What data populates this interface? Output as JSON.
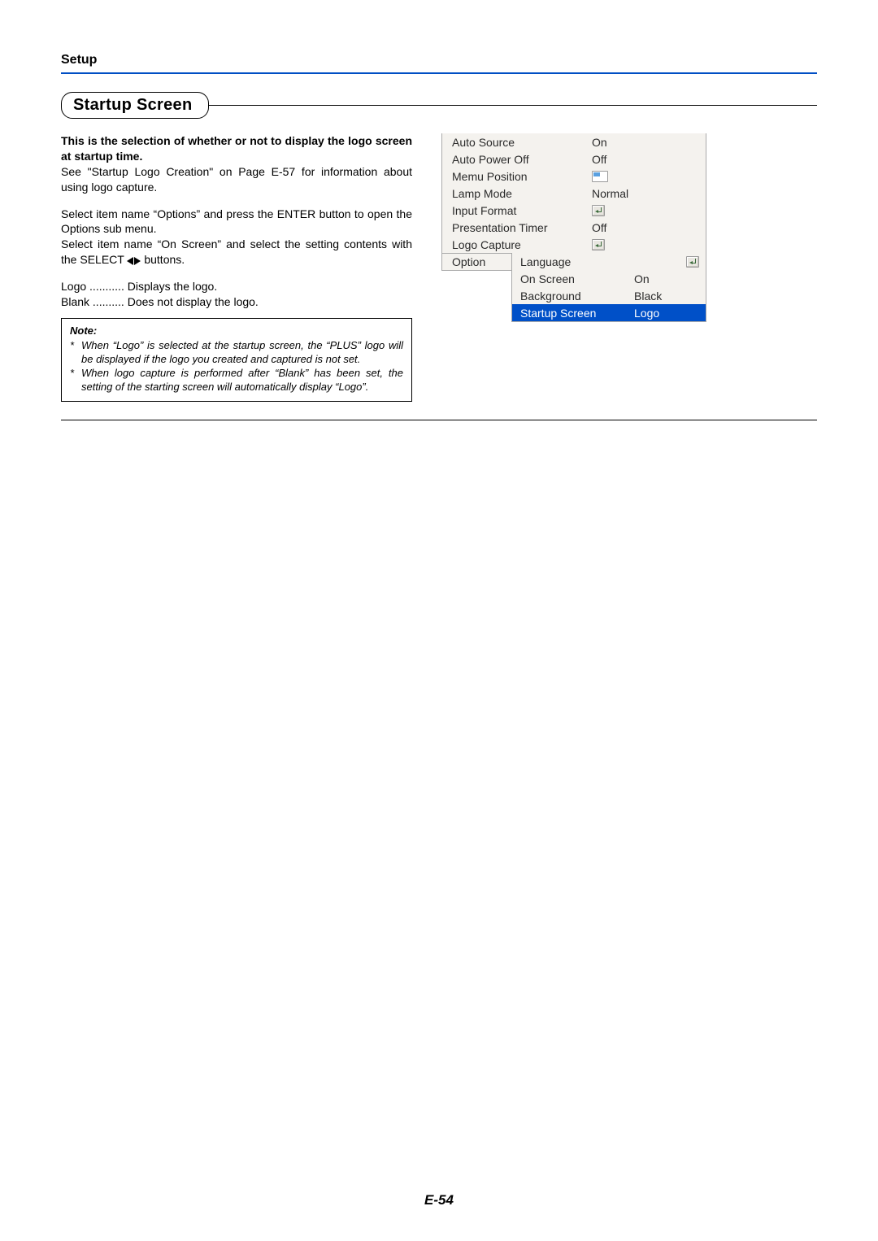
{
  "header": {
    "setup_label": "Setup"
  },
  "title": "Startup Screen",
  "body": {
    "intro_bold": "This is the selection of whether or not to display the logo screen at startup time.",
    "intro_para": "See \"Startup Logo Creation\" on Page E-57 for information about using logo capture.",
    "step1": "Select item name “Options” and press the ENTER button to open the Options sub menu.",
    "step2_a": "Select item name “On Screen” and select the setting contents with the SELECT ",
    "step2_b": " buttons.",
    "desc": [
      {
        "term": "Logo",
        "dots": "...........",
        "val": "Displays the logo."
      },
      {
        "term": "Blank",
        "dots": "..........",
        "val": "Does not display the logo."
      }
    ]
  },
  "note": {
    "heading": "Note:",
    "items": [
      "When “Logo” is selected at the startup screen, the “PLUS” logo will be displayed if the logo you created and captured is not set.",
      "When logo capture is performed after “Blank” has been set, the setting of the starting screen will automatically display “Logo”."
    ],
    "asterisk": "*"
  },
  "menu": {
    "rows": [
      {
        "label": "Auto Source",
        "val": "On",
        "icon": null
      },
      {
        "label": "Auto Power Off",
        "val": "Off",
        "icon": null
      },
      {
        "label": "Memu Position",
        "val": "",
        "icon": "pos"
      },
      {
        "label": "Lamp Mode",
        "val": "Normal",
        "icon": null
      },
      {
        "label": "Input Format",
        "val": "",
        "icon": "enter"
      },
      {
        "label": "Presentation Timer",
        "val": "Off",
        "icon": null
      },
      {
        "label": "Logo Capture",
        "val": "",
        "icon": "enter"
      }
    ],
    "option_label": "Option",
    "sub": [
      {
        "label": "Language",
        "val": "",
        "icon": "enter",
        "selected": false
      },
      {
        "label": "On Screen",
        "val": "On",
        "icon": null,
        "selected": false
      },
      {
        "label": "Background",
        "val": "Black",
        "icon": null,
        "selected": false
      },
      {
        "label": "Startup Screen",
        "val": "Logo",
        "icon": null,
        "selected": true
      }
    ]
  },
  "page_number": "E-54"
}
